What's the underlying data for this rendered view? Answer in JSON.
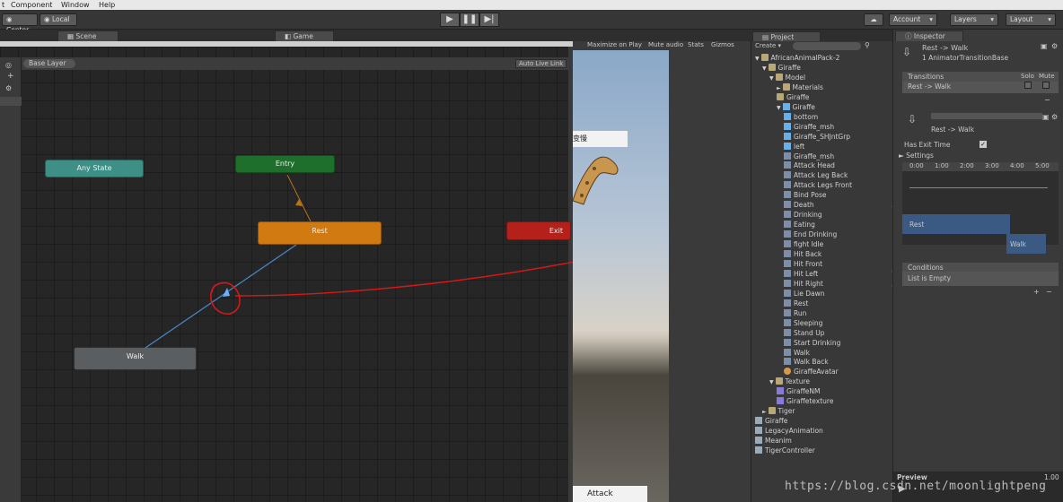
{
  "menu": {
    "items": [
      "t",
      "Component",
      "Window",
      "Help"
    ]
  },
  "toolbar": {
    "pivot_label": "Center",
    "space_label": "Local",
    "account_label": "Account",
    "layers_label": "Layers",
    "layout_label": "Layout"
  },
  "tabs": {
    "scene": "Scene",
    "game": "Game",
    "project": "Project",
    "inspector": "Inspector"
  },
  "animator": {
    "layer": "Base Layer",
    "auto_live_link": "Auto Live Link",
    "states": {
      "any": "Any State",
      "entry": "Entry",
      "rest": "Rest",
      "exit": "Exit",
      "walk": "Walk"
    }
  },
  "game": {
    "maximize": "Maximize on Play",
    "mute": "Mute audio",
    "stats": "Stats",
    "gizmos": "Gizmos",
    "label_top": "变慢",
    "attack_button": "Attack"
  },
  "project": {
    "create": "Create",
    "tree": [
      {
        "label": "AfricanAnimalPack-2",
        "icon": "folder-icon",
        "indent": 0,
        "arrow": "▼"
      },
      {
        "label": "Giraffe",
        "icon": "folder-icon",
        "indent": 1,
        "arrow": "▼"
      },
      {
        "label": "Model",
        "icon": "folder-icon",
        "indent": 2,
        "arrow": "▼"
      },
      {
        "label": "Materials",
        "icon": "folder-icon",
        "indent": 3,
        "arrow": "►"
      },
      {
        "label": "Giraffe",
        "icon": "folder-icon",
        "indent": 3,
        "arrow": ""
      },
      {
        "label": "Giraffe",
        "icon": "model-icon",
        "indent": 3,
        "arrow": "▼"
      },
      {
        "label": "bottom",
        "icon": "mesh-icon",
        "indent": 4,
        "arrow": ""
      },
      {
        "label": "Giraffe_msh",
        "icon": "mesh-icon",
        "indent": 4,
        "arrow": ""
      },
      {
        "label": "Giraffe_SHJntGrp",
        "icon": "mesh-icon",
        "indent": 4,
        "arrow": ""
      },
      {
        "label": "left",
        "icon": "mesh-icon",
        "indent": 4,
        "arrow": ""
      },
      {
        "label": "Giraffe_msh",
        "icon": "anim-icon",
        "indent": 4,
        "arrow": ""
      },
      {
        "label": "Attack Head",
        "icon": "anim-icon",
        "indent": 4,
        "arrow": ""
      },
      {
        "label": "Attack Leg Back",
        "icon": "anim-icon",
        "indent": 4,
        "arrow": ""
      },
      {
        "label": "Attack Legs Front",
        "icon": "anim-icon",
        "indent": 4,
        "arrow": ""
      },
      {
        "label": "Bind Pose",
        "icon": "anim-icon",
        "indent": 4,
        "arrow": ""
      },
      {
        "label": "Death",
        "icon": "anim-icon",
        "indent": 4,
        "arrow": ""
      },
      {
        "label": "Drinking",
        "icon": "anim-icon",
        "indent": 4,
        "arrow": ""
      },
      {
        "label": "Eating",
        "icon": "anim-icon",
        "indent": 4,
        "arrow": ""
      },
      {
        "label": "End Drinking",
        "icon": "anim-icon",
        "indent": 4,
        "arrow": ""
      },
      {
        "label": "fight Idle",
        "icon": "anim-icon",
        "indent": 4,
        "arrow": ""
      },
      {
        "label": "Hit Back",
        "icon": "anim-icon",
        "indent": 4,
        "arrow": ""
      },
      {
        "label": "Hit Front",
        "icon": "anim-icon",
        "indent": 4,
        "arrow": ""
      },
      {
        "label": "Hit Left",
        "icon": "anim-icon",
        "indent": 4,
        "arrow": ""
      },
      {
        "label": "Hit Right",
        "icon": "anim-icon",
        "indent": 4,
        "arrow": ""
      },
      {
        "label": "Lie Dawn",
        "icon": "anim-icon",
        "indent": 4,
        "arrow": ""
      },
      {
        "label": "Rest",
        "icon": "anim-icon",
        "indent": 4,
        "arrow": ""
      },
      {
        "label": "Run",
        "icon": "anim-icon",
        "indent": 4,
        "arrow": ""
      },
      {
        "label": "Sleeping",
        "icon": "anim-icon",
        "indent": 4,
        "arrow": ""
      },
      {
        "label": "Stand Up",
        "icon": "anim-icon",
        "indent": 4,
        "arrow": ""
      },
      {
        "label": "Start Drinking",
        "icon": "anim-icon",
        "indent": 4,
        "arrow": ""
      },
      {
        "label": "Walk",
        "icon": "anim-icon",
        "indent": 4,
        "arrow": ""
      },
      {
        "label": "Walk Back",
        "icon": "anim-icon",
        "indent": 4,
        "arrow": ""
      },
      {
        "label": "GiraffeAvatar",
        "icon": "avatar-icon",
        "indent": 4,
        "arrow": ""
      },
      {
        "label": "Texture",
        "icon": "folder-icon",
        "indent": 2,
        "arrow": "▼"
      },
      {
        "label": "GiraffeNM",
        "icon": "texture-icon",
        "indent": 3,
        "arrow": ""
      },
      {
        "label": "Giraffetexture",
        "icon": "texture-icon",
        "indent": 3,
        "arrow": ""
      },
      {
        "label": "Tiger",
        "icon": "folder-icon",
        "indent": 1,
        "arrow": "►"
      },
      {
        "label": "Giraffe",
        "icon": "controller-icon",
        "indent": 0,
        "arrow": ""
      },
      {
        "label": "LegacyAnimation",
        "icon": "controller-icon",
        "indent": 0,
        "arrow": ""
      },
      {
        "label": "Meanim",
        "icon": "controller-icon",
        "indent": 0,
        "arrow": ""
      },
      {
        "label": "TigerController",
        "icon": "controller-icon",
        "indent": 0,
        "arrow": ""
      }
    ]
  },
  "inspector": {
    "title": "Rest -> Walk",
    "subtitle": "1 AnimatorTransitionBase",
    "transitions_header": "Transitions",
    "solo": "Solo",
    "mute": "Mute",
    "transition_row": "Rest -> Walk",
    "transition_name": "Rest -> Walk",
    "has_exit_time": "Has Exit Time",
    "settings": "Settings",
    "timeline_ticks": [
      "0:00",
      "1:00",
      "2:00",
      "3:00",
      "4:00",
      "5:00"
    ],
    "track_rest": "Rest",
    "track_walk": "Walk",
    "conditions_header": "Conditions",
    "conditions_empty": "List is Empty",
    "preview": "Preview",
    "preview_speed": "1.00"
  },
  "watermark": "https://blog.csdn.net/moonlightpeng"
}
